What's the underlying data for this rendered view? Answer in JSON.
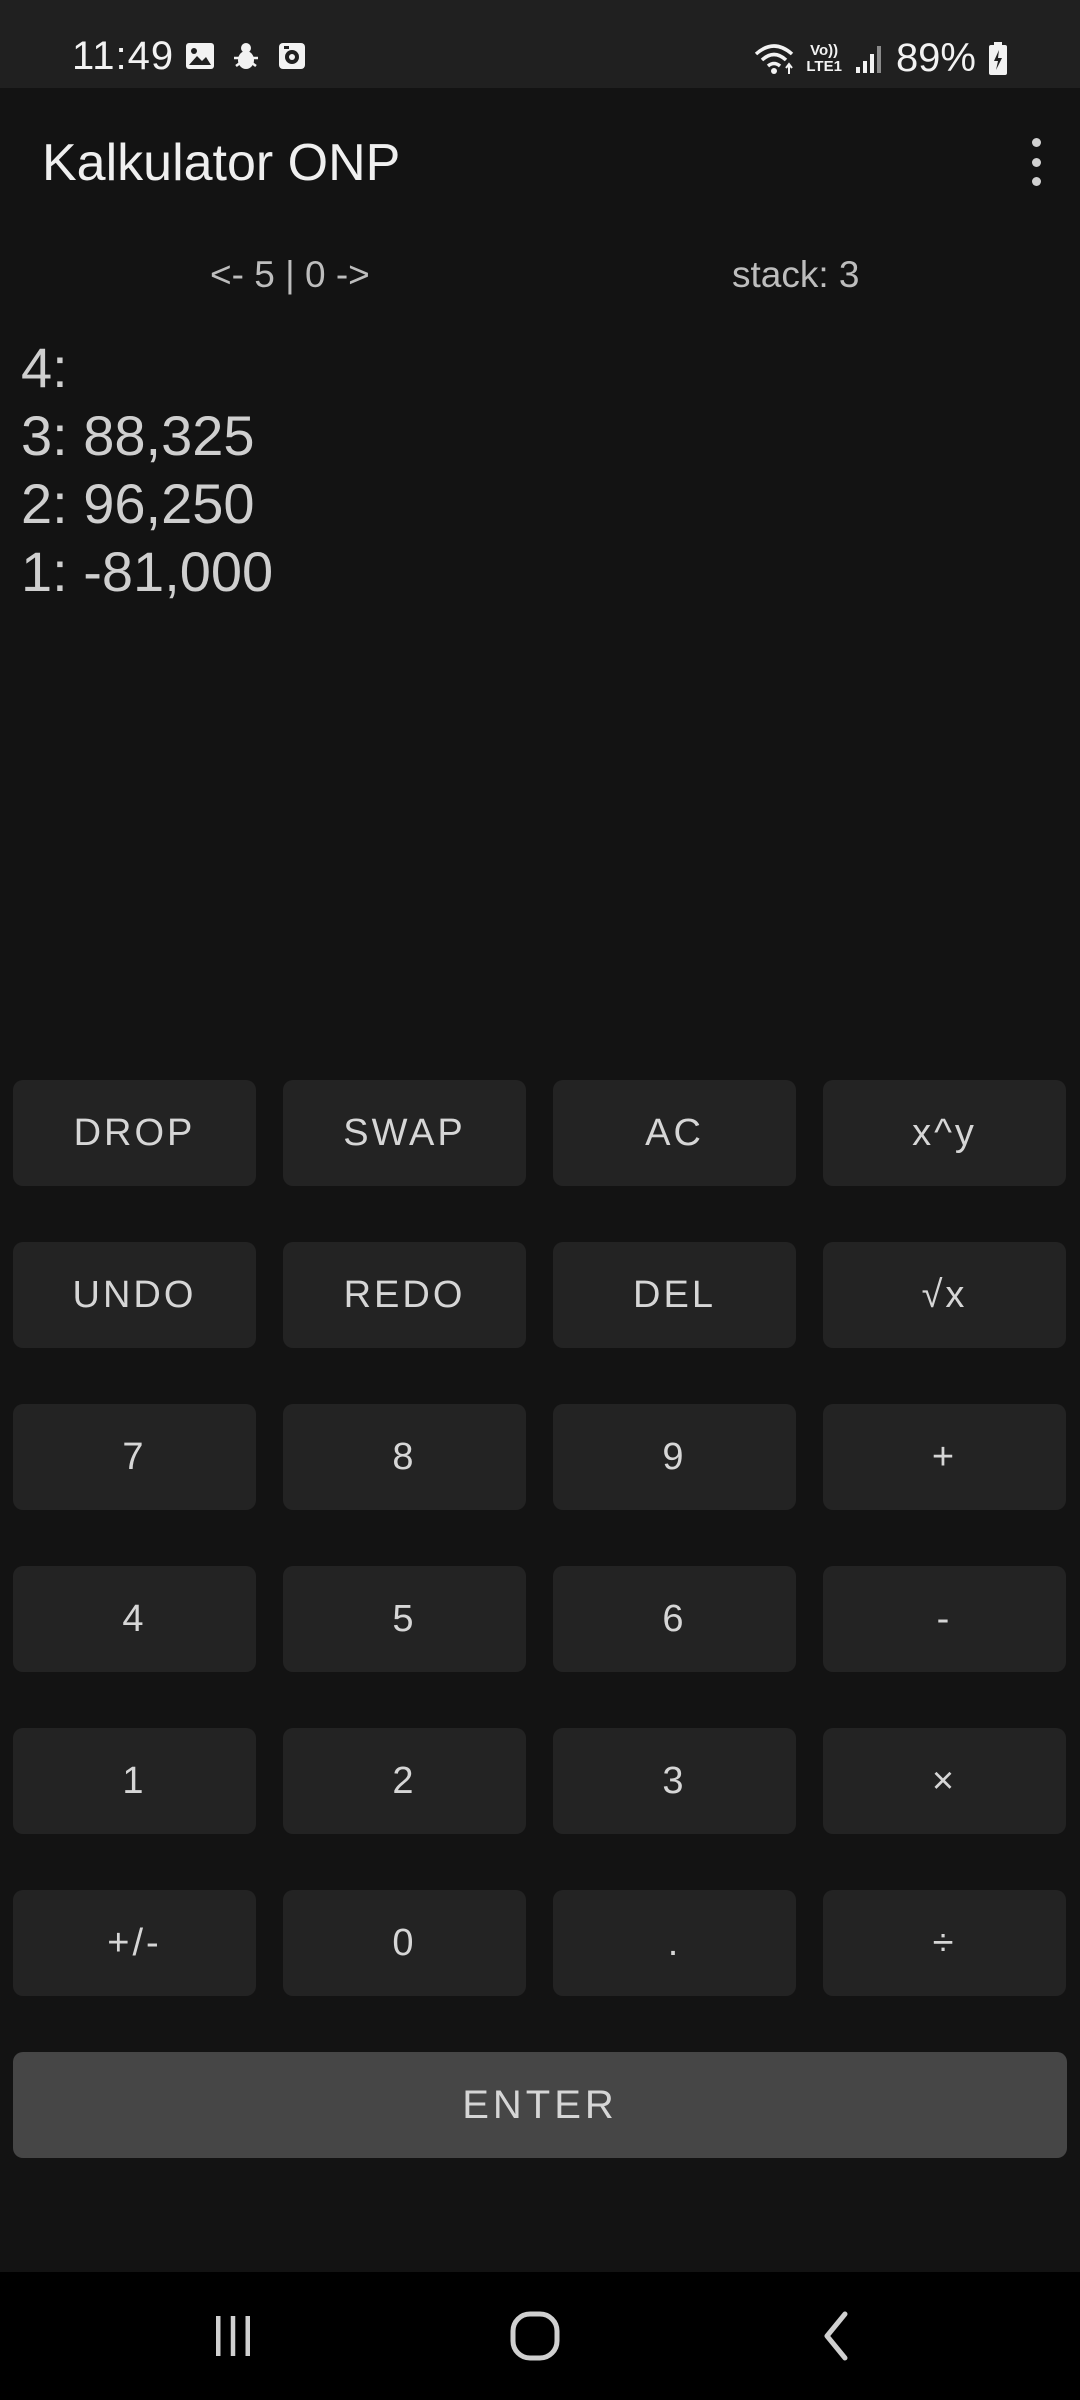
{
  "status_bar": {
    "time": "11:49",
    "battery": "89%",
    "network_label_top": "Vo))",
    "network_label_bottom": "LTE1",
    "icons": [
      "image-icon",
      "bug-icon",
      "media-icon",
      "wifi-icon",
      "volte-icon",
      "signal-icon",
      "battery-charging-icon"
    ]
  },
  "app_bar": {
    "title": "Kalkulator ONP",
    "menu_icon": "more-vert-icon"
  },
  "info": {
    "history_nav": "<- 5 | 0 ->",
    "stack_count": "stack: 3"
  },
  "stack": {
    "lines": [
      "4:",
      "3: 88,325",
      "2: 96,250",
      "1: -81,000"
    ]
  },
  "keypad": {
    "rows": [
      [
        "DROP",
        "SWAP",
        "AC",
        "x^y"
      ],
      [
        "UNDO",
        "REDO",
        "DEL",
        "√x"
      ],
      [
        "7",
        "8",
        "9",
        "+"
      ],
      [
        "4",
        "5",
        "6",
        "-"
      ],
      [
        "1",
        "2",
        "3",
        "×"
      ],
      [
        "+/-",
        "0",
        ".",
        "÷"
      ]
    ],
    "enter": "ENTER"
  },
  "nav_bar": {
    "icons": [
      "recent-apps-icon",
      "home-icon",
      "back-icon"
    ]
  },
  "colors": {
    "background": "#131313",
    "status_bar": "#202020",
    "button": "#232323",
    "enter_button": "#464646",
    "nav_bar": "#000000",
    "text": "#d6d6d6"
  }
}
